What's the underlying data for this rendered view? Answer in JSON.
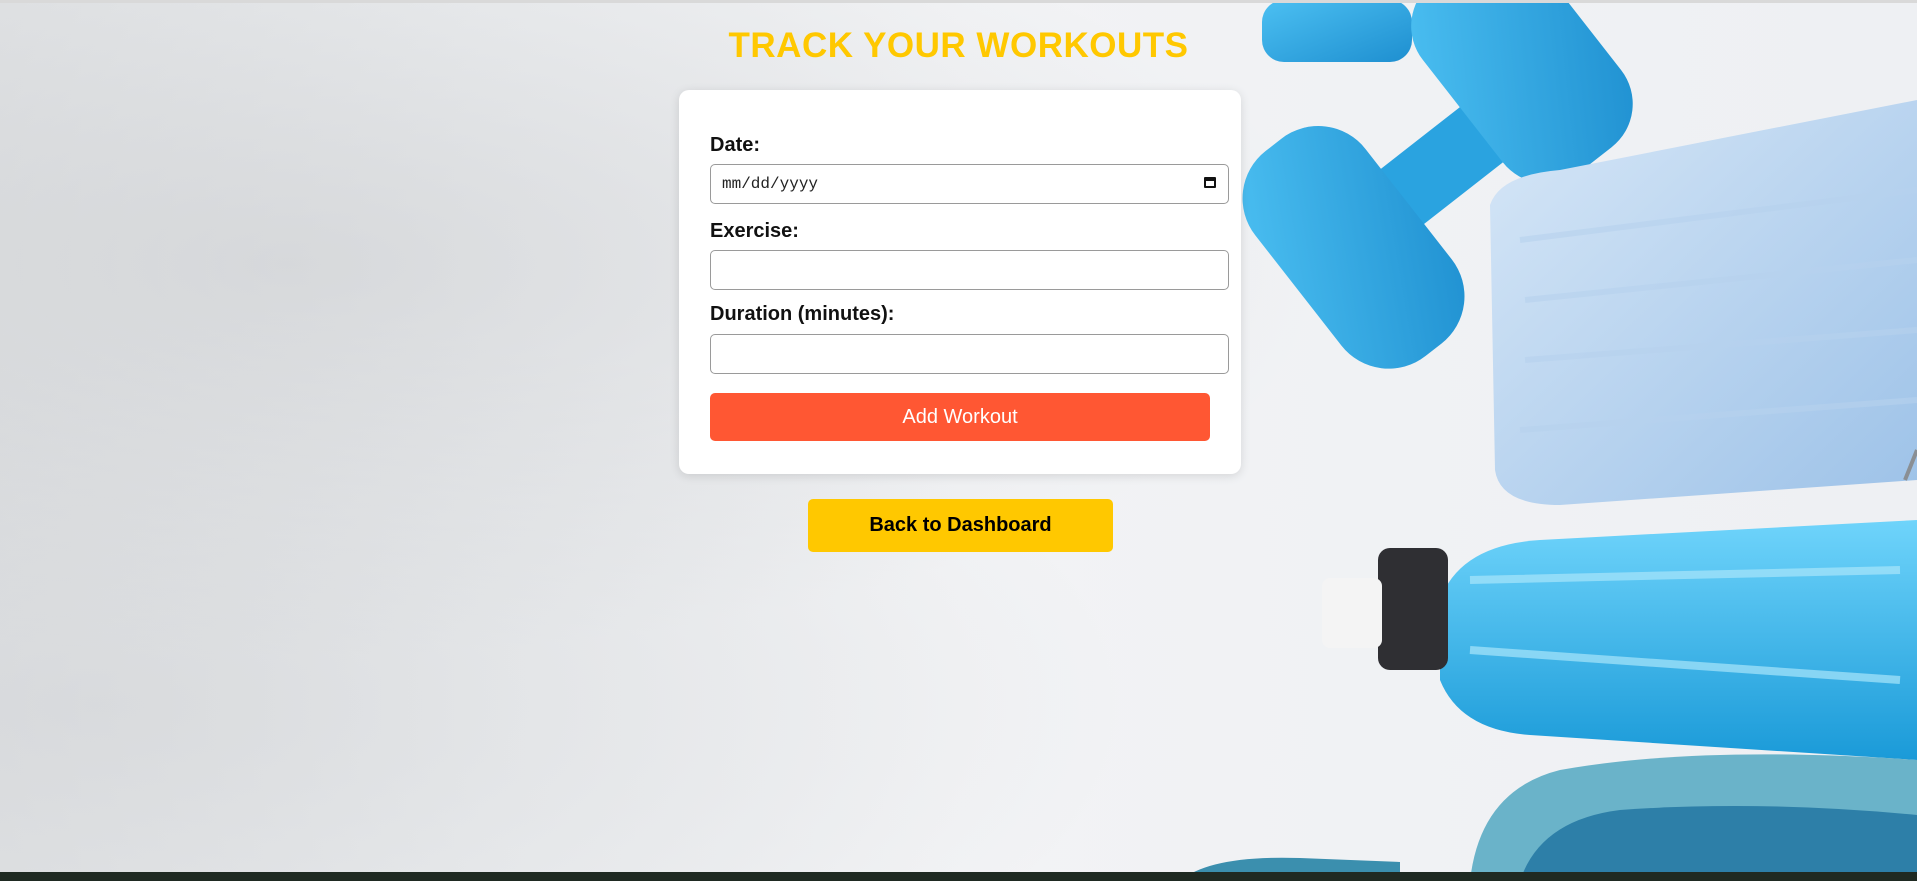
{
  "page": {
    "title": "TRACK YOUR WORKOUTS"
  },
  "form": {
    "date_label": "Date:",
    "date_placeholder": "mm/dd/yyyy",
    "exercise_label": "Exercise:",
    "exercise_value": "",
    "duration_label": "Duration (minutes):",
    "duration_value": "",
    "submit_label": "Add Workout"
  },
  "nav": {
    "back_label": "Back to Dashboard"
  },
  "colors": {
    "title": "#ffc800",
    "add_button": "#ff5733",
    "back_button": "#ffc800",
    "accent_blue": "#2aa3e0"
  },
  "background": {
    "icon": "fitness-equipment-photo"
  }
}
